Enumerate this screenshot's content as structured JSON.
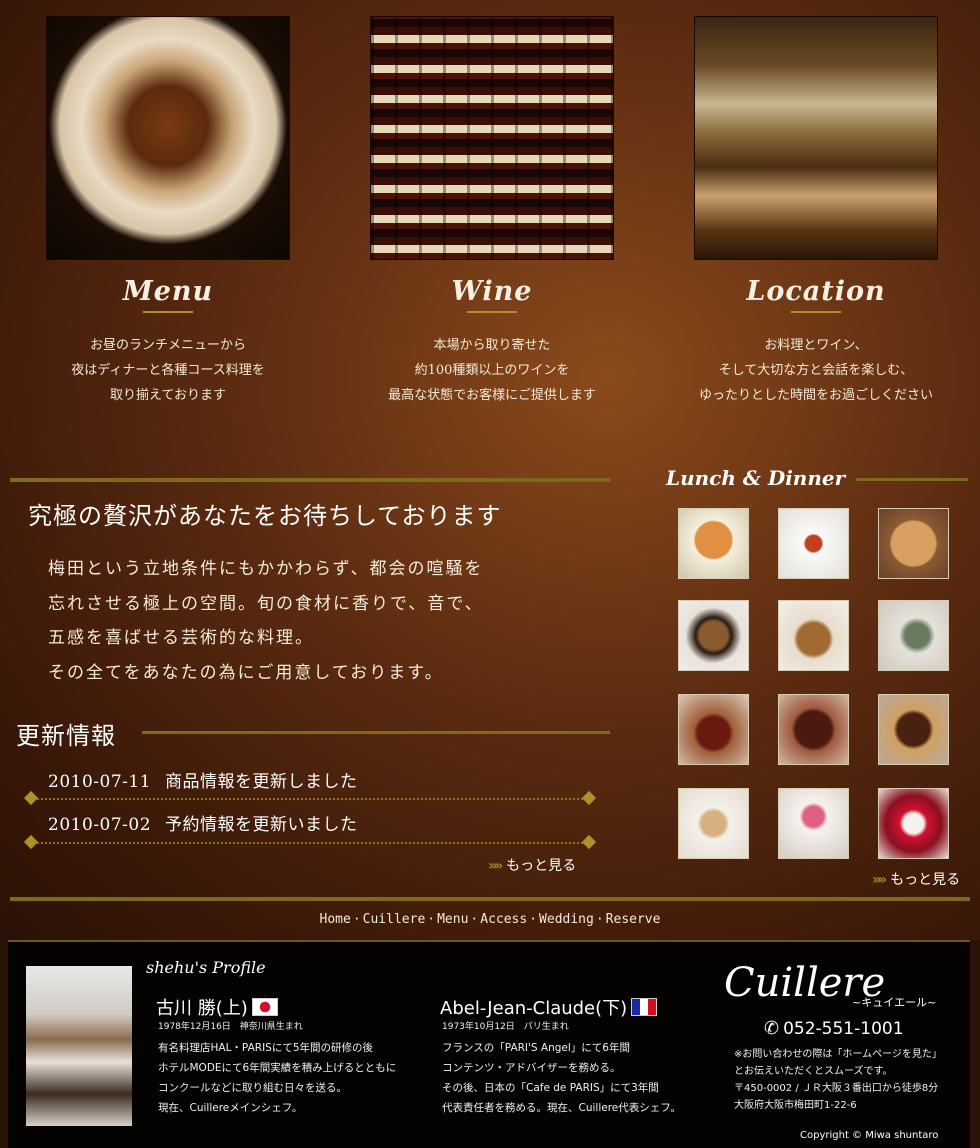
{
  "features": [
    {
      "title": "Menu",
      "text": "お昼のランチメニューから\n夜はディナーと各種コース料理を\n取り揃えております"
    },
    {
      "title": "Wine",
      "text": "本場から取り寄せた\n約100種類以上のワインを\n最高な状態でお客様にご提供します"
    },
    {
      "title": "Location",
      "text": "お料理とワイン、\nそして大切な方と会話を楽しむ、\nゆったりとした時間をお過ごしください"
    }
  ],
  "main": {
    "title": "究極の贅沢があなたをお待ちしております",
    "body": "梅田という立地条件にもかかわらず、都会の喧騒を\n忘れさせる極上の空間。旬の食材に香りで、音で、\n五感を喜ばせる芸術的な料理。\nその全てをあなたの為にご用意しております。"
  },
  "news": {
    "title": "更新情報",
    "items": [
      {
        "date": "2010-07-11",
        "text": "商品情報を更新しました"
      },
      {
        "date": "2010-07-02",
        "text": "予約情報を更新いました"
      }
    ],
    "more": "もっと見る"
  },
  "lunch_dinner": {
    "title": "Lunch & Dinner",
    "more": "もっと見る"
  },
  "nav": [
    "Home",
    "Cuillere",
    "Menu",
    "Access",
    "Wedding",
    "Reserve"
  ],
  "profile": {
    "title": "shehu's Profile",
    "chefs": [
      {
        "name": "古川 勝(上)",
        "sub": "1978年12月16日　神奈川県生まれ",
        "bio": "有名料理店HAL・PARISにて5年間の研修の後\nホテルMODEにて6年間実績を積み上げるとともに\nコンクールなどに取り組む日々を送る。\n現在、Cuillereメインシェフ。"
      },
      {
        "name": "Abel-Jean-Claude(下)",
        "sub": "1973年10月12日　パリ生まれ",
        "bio": "フランスの「PARI'S Angel」にて6年間\nコンテンツ・アドバイザーを務める。\nその後、日本の「Cafe de PARIS」にて3年間\n代表責任者を務める。現在、Cuillere代表シェフ。"
      }
    ]
  },
  "brand": {
    "name": "Cuillere",
    "sub": "~キュイエール~"
  },
  "contact": {
    "phone": "052-551-1001",
    "text": "※お問い合わせの際は「ホームページを見た」\nとお伝えいただくとスムーズです。\n〒450-0002 / ＪＲ大阪３番出口から徒歩8分\n大阪府大阪市梅田町1-22-6"
  },
  "copyright": "Copyright © Miwa shuntaro"
}
